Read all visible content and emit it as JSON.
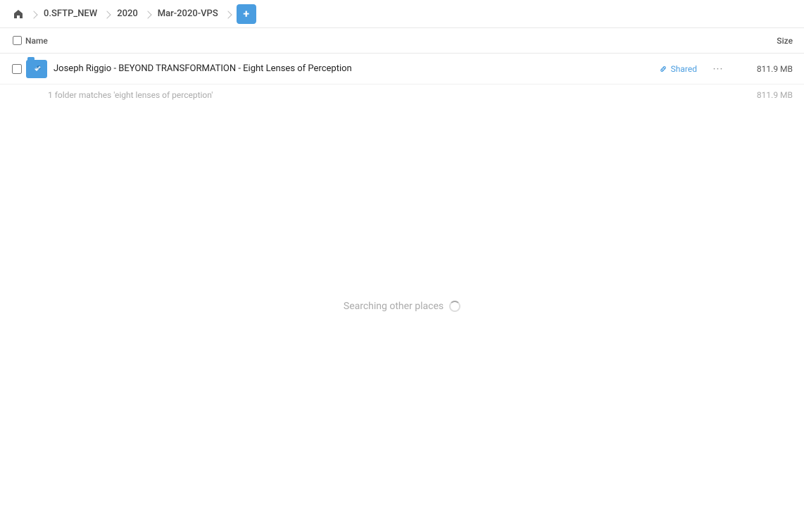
{
  "breadcrumb": {
    "home_icon": "home",
    "items": [
      {
        "label": "0.SFTP_NEW"
      },
      {
        "label": "2020"
      },
      {
        "label": "Mar-2020-VPS"
      }
    ],
    "add_button_label": "+"
  },
  "columns": {
    "name_label": "Name",
    "size_label": "Size"
  },
  "file_row": {
    "name": "Joseph Riggio - BEYOND TRANSFORMATION - Eight Lenses of Perception",
    "shared_label": "Shared",
    "size": "811.9 MB",
    "more_icon": "···"
  },
  "summary": {
    "text": "1 folder matches 'eight lenses of perception'",
    "size": "811.9 MB"
  },
  "searching": {
    "text": "Searching other places"
  }
}
